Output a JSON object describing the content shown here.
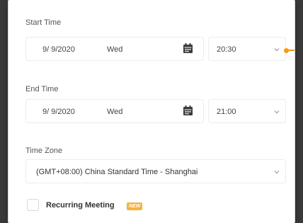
{
  "start": {
    "label": "Start Time",
    "date": "9/ 9/2020",
    "day": "Wed",
    "time": "20:30"
  },
  "end": {
    "label": "End Time",
    "date": "9/ 9/2020",
    "day": "Wed",
    "time": "21:00"
  },
  "timezone": {
    "label": "Time Zone",
    "value": "(GMT+08:00) China Standard Time - Shanghai"
  },
  "recurring": {
    "label": "Recurring Meeting",
    "badge": "NEW"
  },
  "colors": {
    "accent": "#f39c12",
    "badge": "#f4b342",
    "calendar_icon": "#3c3c3c"
  },
  "icons": [
    "calendar-icon",
    "chevron-down-icon"
  ]
}
